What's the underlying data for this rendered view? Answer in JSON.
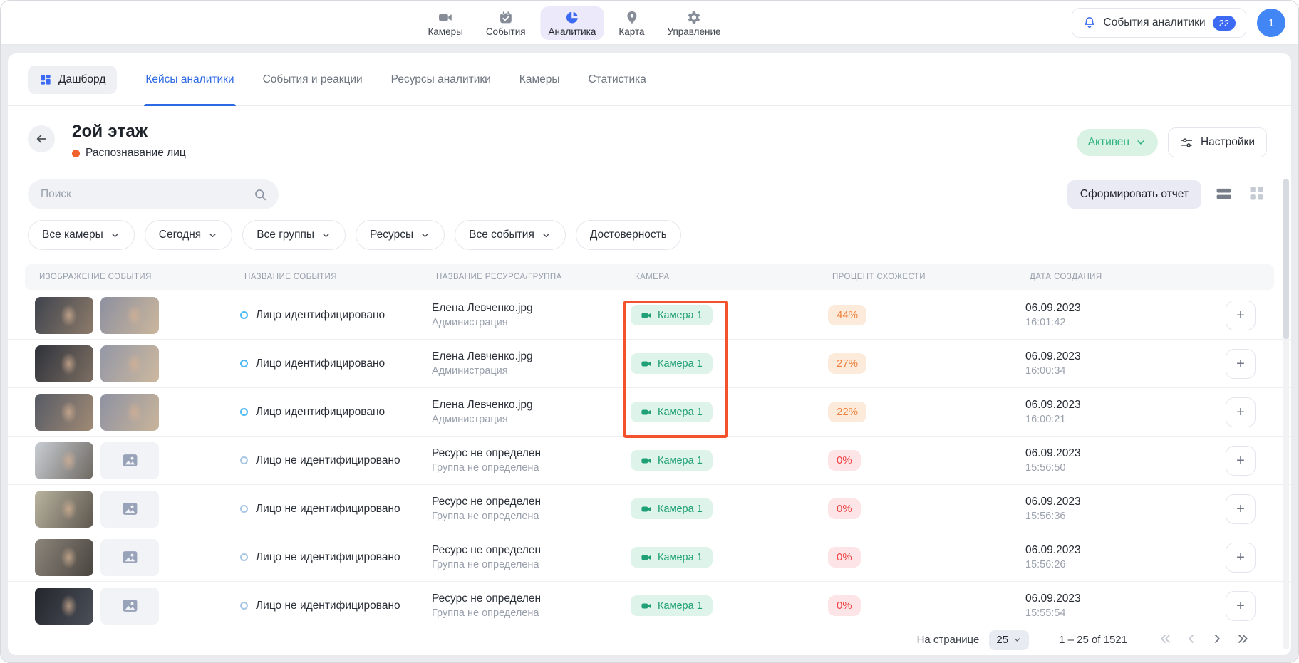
{
  "colors": {
    "accent": "#3d6af2",
    "tab_active": "#2c69e3",
    "green": "#1fa077",
    "green_bg": "#def3e9",
    "status_green": "#2eb27d",
    "status_bg": "#d9f2e4",
    "warn": "#ee8440",
    "warn_bg": "#fceadb",
    "bad": "#ef4444",
    "bad_bg": "#fde5e7",
    "annotation": "#f4512d",
    "orange_dot": "#f2622e"
  },
  "topnav": {
    "items": [
      {
        "id": "cameras",
        "label": "Камеры",
        "icon": "video-camera-icon"
      },
      {
        "id": "events",
        "label": "События",
        "icon": "calendar-icon"
      },
      {
        "id": "analytics",
        "label": "Аналитика",
        "icon": "pie-chart-icon",
        "active": true
      },
      {
        "id": "map",
        "label": "Карта",
        "icon": "map-pin-icon"
      },
      {
        "id": "management",
        "label": "Управление",
        "icon": "gear-icon"
      }
    ]
  },
  "header_right": {
    "events_label": "События аналитики",
    "events_count": "22",
    "avatar": "1"
  },
  "tabs": [
    {
      "id": "dashboard",
      "label": "Дашборд",
      "icon": "dashboard-grid-icon",
      "pill": true
    },
    {
      "id": "analytics-cases",
      "label": "Кейсы аналитики",
      "active": true
    },
    {
      "id": "events-reactions",
      "label": "События и реакции"
    },
    {
      "id": "analytics-resources",
      "label": "Ресурсы аналитики"
    },
    {
      "id": "cameras",
      "label": "Камеры"
    },
    {
      "id": "statistics",
      "label": "Статистика"
    }
  ],
  "case": {
    "title": "2ой этаж",
    "subtitle": "Распознавание лиц",
    "status": "Активен",
    "settings": "Настройки"
  },
  "toolbar": {
    "search_placeholder": "Поиск",
    "report": "Сформировать отчет"
  },
  "filters": [
    {
      "id": "all-cameras",
      "label": "Все камеры",
      "chevron": true
    },
    {
      "id": "today",
      "label": "Сегодня",
      "chevron": true
    },
    {
      "id": "all-groups",
      "label": "Все группы",
      "chevron": true
    },
    {
      "id": "resources",
      "label": "Ресурсы",
      "chevron": true
    },
    {
      "id": "all-events",
      "label": "Все события",
      "chevron": true
    },
    {
      "id": "confidence",
      "label": "Достоверность",
      "chevron": false
    }
  ],
  "table": {
    "plus_label": "+",
    "columns": [
      "ИЗОБРАЖЕНИЕ СОБЫТИЯ",
      "НАЗВАНИЕ СОБЫТИЯ",
      "НАЗВАНИЕ РЕСУРСА/ГРУППА",
      "КАМЕРА",
      "ПРОЦЕНТ СХОЖЕСТИ",
      "ДАТА СОЗДАНИЯ"
    ],
    "rows": [
      {
        "thumbs": [
          [
            "#3f444e",
            "#8d7b6a"
          ],
          [
            "#8d90a0",
            "#cbb69c"
          ]
        ],
        "identified": true,
        "event": "Лицо идентифицировано",
        "resource": "Елена Левченко.jpg",
        "group": "Администрация",
        "camera": "Камера 1",
        "percent": "44%",
        "level": "warn",
        "date": "06.09.2023",
        "time": "16:01:42"
      },
      {
        "thumbs": [
          [
            "#2e323b",
            "#7d6f63"
          ],
          [
            "#9397a6",
            "#cdb89e"
          ]
        ],
        "identified": true,
        "event": "Лицо идентифицировано",
        "resource": "Елена Левченко.jpg",
        "group": "Администрация",
        "camera": "Камера 1",
        "percent": "27%",
        "level": "warn",
        "date": "06.09.2023",
        "time": "16:00:34"
      },
      {
        "thumbs": [
          [
            "#575b66",
            "#a08a74"
          ],
          [
            "#8e92a2",
            "#c9b49a"
          ]
        ],
        "identified": true,
        "event": "Лицо идентифицировано",
        "resource": "Елена Левченко.jpg",
        "group": "Администрация",
        "camera": "Камера 1",
        "percent": "22%",
        "level": "warn",
        "date": "06.09.2023",
        "time": "16:00:21"
      },
      {
        "thumbs": [
          [
            "#c9cdd3",
            "#6e6962"
          ],
          "placeholder"
        ],
        "identified": false,
        "event": "Лицо не идентифицировано",
        "resource": "Ресурс не определен",
        "group": "Группа не определена",
        "camera": "Камера 1",
        "percent": "0%",
        "level": "bad",
        "date": "06.09.2023",
        "time": "15:56:50"
      },
      {
        "thumbs": [
          [
            "#b9b39f",
            "#5d574f"
          ],
          "placeholder"
        ],
        "identified": false,
        "event": "Лицо не идентифицировано",
        "resource": "Ресурс не определен",
        "group": "Группа не определена",
        "camera": "Камера 1",
        "percent": "0%",
        "level": "bad",
        "date": "06.09.2023",
        "time": "15:56:36"
      },
      {
        "thumbs": [
          [
            "#8b857b",
            "#4a453f"
          ],
          "placeholder"
        ],
        "identified": false,
        "event": "Лицо не идентифицировано",
        "resource": "Ресурс не определен",
        "group": "Группа не определена",
        "camera": "Камера 1",
        "percent": "0%",
        "level": "bad",
        "date": "06.09.2023",
        "time": "15:56:26"
      },
      {
        "thumbs": [
          [
            "#23262c",
            "#4b4f58"
          ],
          "placeholder"
        ],
        "identified": false,
        "event": "Лицо не идентифицировано",
        "resource": "Ресурс не определен",
        "group": "Группа не определена",
        "camera": "Камера 1",
        "percent": "0%",
        "level": "bad",
        "date": "06.09.2023",
        "time": "15:55:54"
      }
    ]
  },
  "pagination": {
    "per_page_label": "На странице",
    "per_page": "25",
    "range": "1 – 25 of 1521"
  }
}
